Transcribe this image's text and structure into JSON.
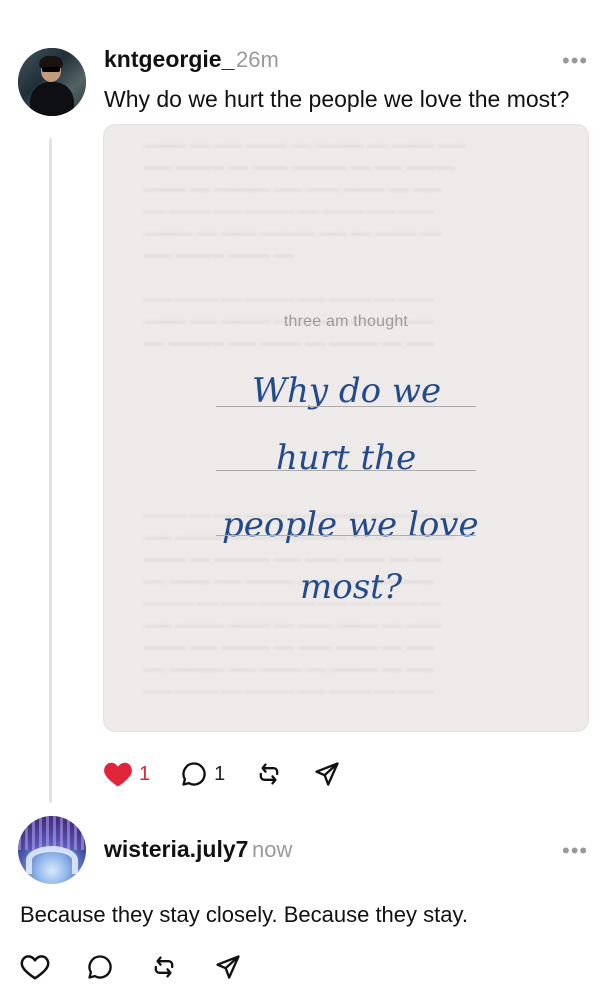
{
  "post1": {
    "username": "kntgeorgie_",
    "time": "26m",
    "more": "•••",
    "text": "Why do we hurt the people we love the most?",
    "image": {
      "caption": "three am thought",
      "handwriting": [
        "Why do we",
        "hurt the",
        "people we love",
        "most?"
      ]
    },
    "likes": "1",
    "comments": "1"
  },
  "post2": {
    "username": "wisteria.july7",
    "time": "now",
    "more": "•••",
    "text": "Because they stay closely. Because they stay."
  },
  "colors": {
    "like_red": "#e0243a",
    "handwriting_blue": "#234b8a"
  },
  "icons": [
    "heart-icon",
    "comment-icon",
    "repost-icon",
    "share-icon"
  ]
}
